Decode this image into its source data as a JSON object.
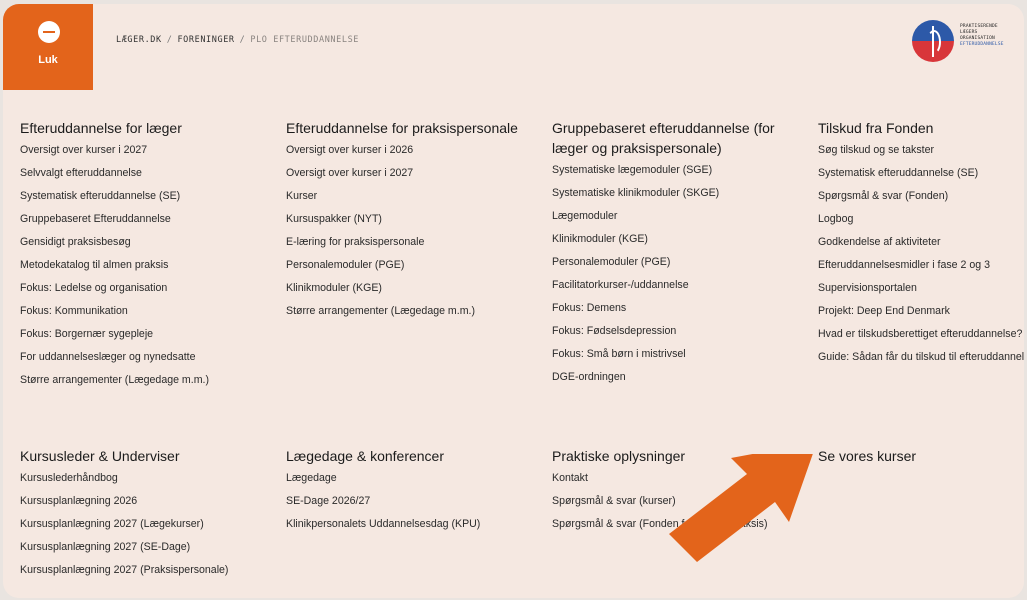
{
  "header": {
    "close_label": "Luk",
    "breadcrumb": [
      "LÆGER.DK",
      "FORENINGER",
      "PLO EFTERUDDANNELSE"
    ],
    "logo_lines": [
      "PRAKTISERENDE",
      "LÆGERS",
      "ORGANISATION",
      "EFTERUDDANNELSE"
    ]
  },
  "columns_top": [
    {
      "heading": "Efteruddannelse for læger",
      "links": [
        "Oversigt over kurser i 2027",
        "Selvvalgt efteruddannelse",
        "Systematisk efteruddannelse (SE)",
        "Gruppebaseret Efteruddannelse",
        "Gensidigt praksisbesøg",
        "Metodekatalog til almen praksis",
        "Fokus: Ledelse og organisation",
        "Fokus: Kommunikation",
        "Fokus: Borgernær sygepleje",
        "For uddannelseslæger og nynedsatte",
        "Større arrangementer (Lægedage m.m.)"
      ]
    },
    {
      "heading": "Efteruddannelse for praksispersonale",
      "links": [
        "Oversigt over kurser i 2026",
        "Oversigt over kurser i 2027",
        "Kurser",
        "Kursuspakker (NYT)",
        "E-læring for praksispersonale",
        "Personalemoduler (PGE)",
        "Klinikmoduler (KGE)",
        "Større arrangementer (Lægedage m.m.)"
      ]
    },
    {
      "heading": "Gruppebaseret efteruddannelse (for læger og praksispersonale)",
      "links": [
        "Systematiske lægemoduler (SGE)",
        "Systematiske klinikmoduler (SKGE)",
        "Lægemoduler",
        "Klinikmoduler (KGE)",
        "Personalemoduler (PGE)",
        "Facilitatorkurser-/uddannelse",
        "Fokus: Demens",
        "Fokus: Fødselsdepression",
        "Fokus: Små børn i mistrivsel",
        "DGE-ordningen"
      ]
    },
    {
      "heading": "Tilskud fra Fonden",
      "links": [
        "Søg tilskud og se takster",
        "Systematisk efteruddannelse (SE)",
        "Spørgsmål & svar (Fonden)",
        "Logbog",
        "Godkendelse af aktiviteter",
        "Efteruddannelsesmidler i fase 2 og 3",
        "Supervisionsportalen",
        "Projekt: Deep End Denmark",
        "Hvad er tilskudsberettiget efteruddannelse?",
        "Guide: Sådan får du tilskud til efteruddannelse"
      ]
    }
  ],
  "columns_bottom": [
    {
      "heading": "Kursusleder & Underviser",
      "links": [
        "Kursuslederhåndbog",
        "Kursusplanlægning 2026",
        "Kursusplanlægning 2027 (Lægekurser)",
        "Kursusplanlægning 2027 (SE-Dage)",
        "Kursusplanlægning 2027 (Praksispersonale)"
      ]
    },
    {
      "heading": "Lægedage & konferencer",
      "links": [
        "Lægedage",
        "SE-Dage 2026/27",
        "Klinikpersonalets Uddannelsesdag (KPU)"
      ]
    },
    {
      "heading": "Praktiske oplysninger",
      "links": [
        "Kontakt",
        "Spørgsmål & svar (kurser)",
        "Spørgsmål & svar (Fonden for Almen Praksis)"
      ]
    },
    {
      "heading": "Se vores kurser",
      "links": []
    }
  ],
  "colors": {
    "accent": "#e3641b",
    "panel_bg": "#f5e8e1",
    "page_bg": "#e9e4e0"
  }
}
